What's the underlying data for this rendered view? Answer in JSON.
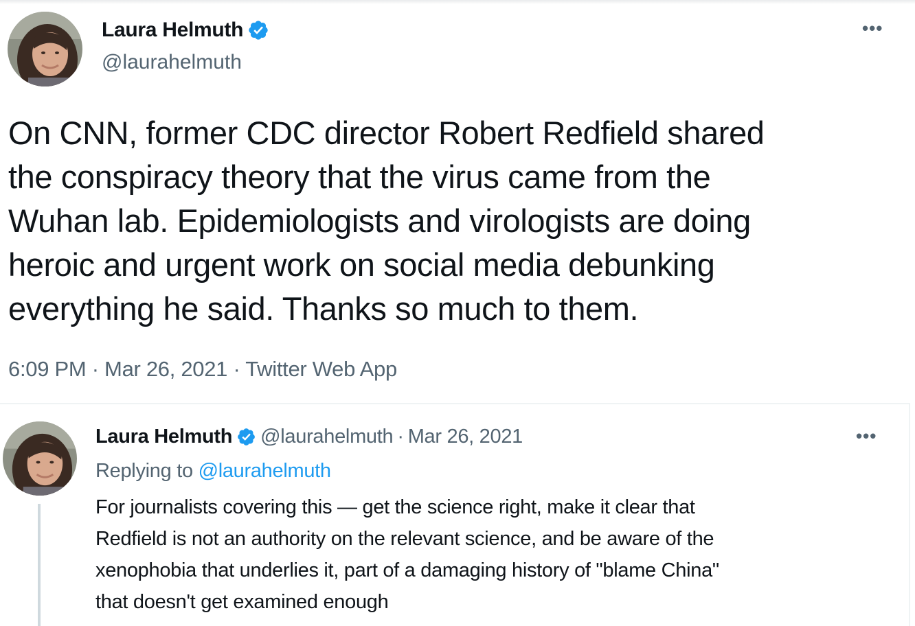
{
  "main_tweet": {
    "author_name": "Laura Helmuth",
    "author_handle": "@laurahelmuth",
    "verified_icon": "verified-badge-icon",
    "more_icon": "more-options-icon",
    "text": "On CNN, former CDC director Robert Redfield shared\nthe conspiracy theory that the virus came from the\nWuhan lab. Epidemiologists and virologists are doing\nheroic and urgent work on social media debunking\neverything he said. Thanks so much to them.",
    "time": "6:09 PM",
    "separator": "·",
    "date": "Mar 26, 2021",
    "source": "Twitter Web App"
  },
  "reply_tweet": {
    "author_name": "Laura Helmuth",
    "author_handle": "@laurahelmuth",
    "separator": "·",
    "date": "Mar 26, 2021",
    "replying_prefix": "Replying to",
    "replying_to": "@laurahelmuth",
    "text": "For journalists covering this — get the science right, make it clear that\nRedfield is not an authority on the relevant science, and be aware of the\nxenophobia that underlies it, part of a damaging history of \"blame China\"\nthat doesn't get examined enough"
  },
  "colors": {
    "accent": "#1d9bf0",
    "text_primary": "#0f1419",
    "text_secondary": "#536471",
    "border": "#eff3f4"
  }
}
